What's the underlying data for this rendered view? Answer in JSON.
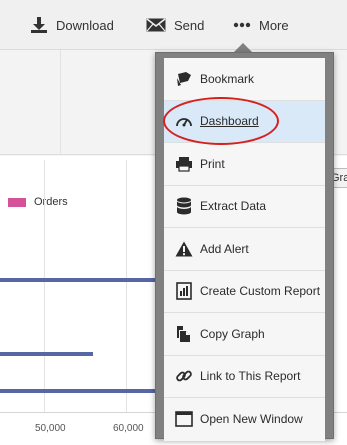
{
  "toolbar": {
    "download_label": "Download",
    "send_label": "Send",
    "more_label": "More",
    "download_icon": "download-icon",
    "send_icon": "envelope-icon",
    "more_icon": "ellipsis-icon"
  },
  "legend": {
    "label": "Orders",
    "color": "#d4529a"
  },
  "partial_tab": "Gra",
  "chart_data": {
    "type": "bar",
    "orientation": "horizontal",
    "categories": [
      "",
      "",
      ""
    ],
    "series": [
      {
        "name": "Orders",
        "values": [
          70000,
          56000,
          70000
        ],
        "color": "#5767a3"
      }
    ],
    "xaxis": {
      "tick_labels": [
        "50,000",
        "60,000"
      ]
    },
    "grid": true,
    "legend_placement": "top-left"
  },
  "menu": {
    "items": [
      {
        "label": "Bookmark",
        "icon": "bookmark-icon",
        "selected": false
      },
      {
        "label": "Dashboard",
        "icon": "gauge-icon",
        "selected": true
      },
      {
        "label": "Print",
        "icon": "printer-icon",
        "selected": false
      },
      {
        "label": "Extract Data",
        "icon": "database-icon",
        "selected": false
      },
      {
        "label": "Add Alert",
        "icon": "warning-icon",
        "selected": false
      },
      {
        "label": "Create Custom Report",
        "icon": "report-icon",
        "selected": false
      },
      {
        "label": "Copy Graph",
        "icon": "copy-icon",
        "selected": false
      },
      {
        "label": "Link to This Report",
        "icon": "link-icon",
        "selected": false
      },
      {
        "label": "Open New Window",
        "icon": "window-icon",
        "selected": false
      }
    ]
  }
}
